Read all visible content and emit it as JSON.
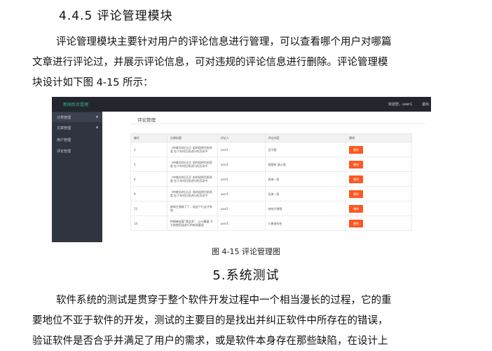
{
  "section_heading": "4.4.5 评论管理模块",
  "paragraph1": [
    "评论管理模块主要针对用户的评论信息进行管理，可以查看哪个用户对哪篇",
    "文章进行评论过，并展示评论信息，可对违规的评论信息进行删除。评论管理模",
    "块设计如下图 4-15 所示："
  ],
  "screenshot": {
    "brand": "新闻后台管理",
    "welcome": "欢迎您，user1",
    "logout": "退出",
    "sidebar": [
      {
        "label": "分类管理",
        "arrow": "▼"
      },
      {
        "label": "文章管理",
        "arrow": "▼"
      },
      {
        "label": "用户管理",
        "arrow": ""
      },
      {
        "label": "评论管理",
        "arrow": ""
      }
    ],
    "page_title": "评论管理",
    "columns": [
      "编号",
      "文章标题",
      "评论人",
      "评论内容",
      "删除"
    ],
    "rows": [
      {
        "id": "4",
        "title": "《仲裁员的日记》前时段将目前多类 在少年时后续进行的活动中",
        "user": "user1",
        "content": "还不错",
        "btn": "删除"
      },
      {
        "id": "5",
        "title": "《仲裁员的日记》前时段将目前多类 在少年时后续进行的活动中",
        "user": "user1",
        "content": "图图有 表示表",
        "btn": "删除"
      },
      {
        "id": "6",
        "title": "《仲裁员的日记》前时段将目前多类 在少年时后续进行的活动中",
        "user": "user1",
        "content": "再来一条",
        "btn": "删除"
      },
      {
        "id": "9",
        "title": "《仲裁员的日记》前时段将目前多类 在少年时后续进行的活动中",
        "user": "user1",
        "content": "还来一条",
        "btn": "删除"
      },
      {
        "id": "13",
        "title": "新闻主角换了了，说这个行这才有效",
        "user": "user1",
        "content": "哈哈不错哦",
        "btn": "删除"
      },
      {
        "id": "14",
        "title": "特朗普说要\"我会多\"，让计算器 不立刻使用该进行的新闻要造",
        "user": "user1",
        "content": "川普说的也",
        "btn": "删除"
      }
    ]
  },
  "figure_caption": "图 4-15  评论管理图",
  "main_heading": "5.系统测试",
  "paragraph2": [
    "软件系统的测试是贯穿于整个软件开发过程中一个相当漫长的过程，它的重",
    "要地位不亚于软件的开发，测试的主要目的是找出并纠正软件中所存在的错误，",
    "验证软件是否合乎并满足了用户的需求，或是软件本身存在那些缺陷，在设计上"
  ]
}
